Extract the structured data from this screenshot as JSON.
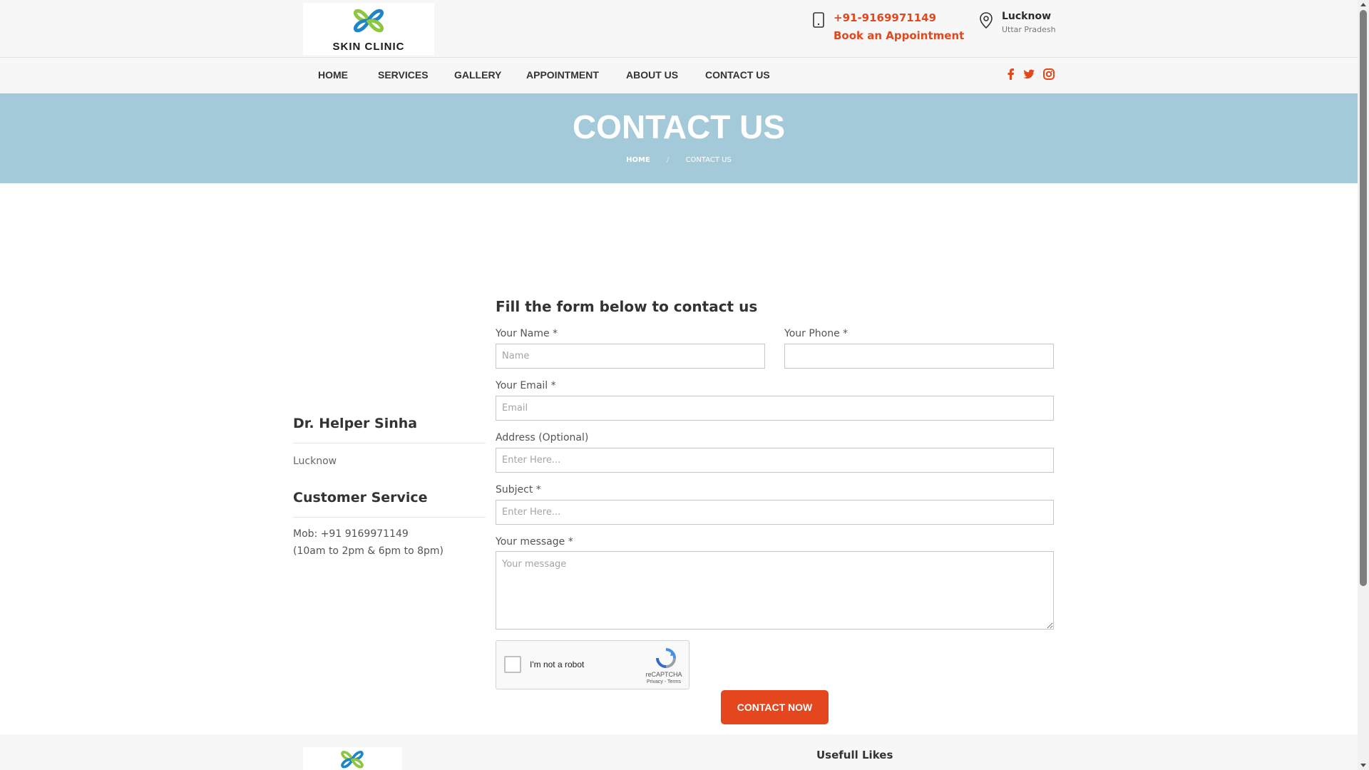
{
  "brand": {
    "name": "SKIN CLINIC",
    "colors": {
      "accent": "#e4471d",
      "hero": "#a4cad9",
      "logo_green": "#8dc63f",
      "logo_blue": "#1e86c8"
    }
  },
  "header": {
    "phone": "+91-9169971149",
    "appointment_label": "Book an Appointment",
    "location_city": "Lucknow",
    "location_state": "Uttar Pradesh"
  },
  "nav": {
    "items": [
      "HOME",
      "SERVICES",
      "GALLERY",
      "APPOINTMENT",
      "ABOUT US",
      "CONTACT US"
    ],
    "social": [
      "facebook-icon",
      "twitter-icon",
      "instagram-icon"
    ]
  },
  "hero": {
    "title": "CONTACT US",
    "breadcrumb": {
      "home": "HOME",
      "separator": "/",
      "current": "CONTACT US"
    }
  },
  "sidebar": {
    "doctor_name": "Dr. Helper Sinha",
    "doctor_city": "Lucknow",
    "service_title": "Customer Service",
    "mobile": "Mob: +91 9169971149",
    "hours": "(10am to 2pm & 6pm to 8pm)"
  },
  "form": {
    "heading": "Fill the form below to contact us",
    "name": {
      "label": "Your Name *",
      "placeholder": "Name",
      "value": ""
    },
    "phone": {
      "label": "Your Phone *",
      "placeholder": "",
      "value": ""
    },
    "email": {
      "label": "Your Email *",
      "placeholder": "Email",
      "value": ""
    },
    "address": {
      "label": "Address (Optional)",
      "placeholder": "Enter Here...",
      "value": ""
    },
    "subject": {
      "label": "Subject *",
      "placeholder": "Enter Here...",
      "value": ""
    },
    "message": {
      "label": "Your message *",
      "placeholder": "Your message",
      "value": ""
    },
    "captcha": {
      "label": "I'm not a robot",
      "brand": "reCAPTCHA",
      "terms": "Privacy - Terms",
      "checked": false
    },
    "submit_label": "CONTACT NOW"
  },
  "footer": {
    "heading": "Usefull Likes"
  }
}
